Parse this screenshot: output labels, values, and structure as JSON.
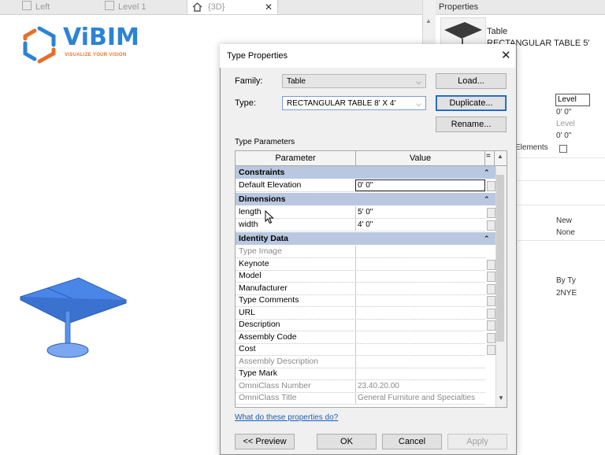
{
  "tabs": [
    {
      "label": "Left",
      "icon": "view-icon"
    },
    {
      "label": "Level 1",
      "icon": "plan-icon"
    },
    {
      "label": "{3D}",
      "icon": "home-icon",
      "active": true
    }
  ],
  "logo": {
    "name": "ViBIM",
    "reg": "®",
    "tagline": "VISUALIZE YOUR VISION",
    "colors": {
      "blue": "#2c83d6",
      "orange": "#e5702a"
    }
  },
  "properties": {
    "title": "Properties",
    "type_line1": "Table",
    "type_line2": "RECTANGULAR TABLE 5'",
    "values": [
      "Level",
      "0'  0\"",
      "Level",
      "0'  0\""
    ],
    "elements_label": "Elements",
    "more_values": [
      "New",
      "None",
      "By Ty",
      "2NYE"
    ]
  },
  "dialog": {
    "title": "Type Properties",
    "family_label": "Family:",
    "family_value": "Table",
    "type_label": "Type:",
    "type_value": "RECTANGULAR TABLE 8' X 4'",
    "load_label": "Load...",
    "duplicate_label": "Duplicate...",
    "rename_label": "Rename...",
    "type_params_label": "Type Parameters",
    "col_parameter": "Parameter",
    "col_value": "Value",
    "col_eq": "=",
    "groups": {
      "constraints": "Constraints",
      "dimensions": "Dimensions",
      "identity": "Identity Data"
    },
    "rows": {
      "default_elevation": {
        "p": "Default Elevation",
        "v": "0'  0\""
      },
      "length": {
        "p": "length",
        "v": "5'  0\""
      },
      "width": {
        "p": "width",
        "v": "4'  0\""
      },
      "type_image": {
        "p": "Type Image",
        "v": ""
      },
      "keynote": {
        "p": "Keynote",
        "v": ""
      },
      "model": {
        "p": "Model",
        "v": ""
      },
      "manufacturer": {
        "p": "Manufacturer",
        "v": ""
      },
      "type_comments": {
        "p": "Type Comments",
        "v": ""
      },
      "url": {
        "p": "URL",
        "v": ""
      },
      "description": {
        "p": "Description",
        "v": ""
      },
      "assembly_code": {
        "p": "Assembly Code",
        "v": ""
      },
      "cost": {
        "p": "Cost",
        "v": ""
      },
      "assembly_description": {
        "p": "Assembly Description",
        "v": ""
      },
      "type_mark": {
        "p": "Type Mark",
        "v": ""
      },
      "omniclass_number": {
        "p": "OmniClass Number",
        "v": "23.40.20.00"
      },
      "omniclass_title": {
        "p": "OmniClass Title",
        "v": "General Furniture and Specialties"
      }
    },
    "help_link": "What do these properties do?",
    "preview_label": "<< Preview",
    "ok_label": "OK",
    "cancel_label": "Cancel",
    "apply_label": "Apply"
  }
}
